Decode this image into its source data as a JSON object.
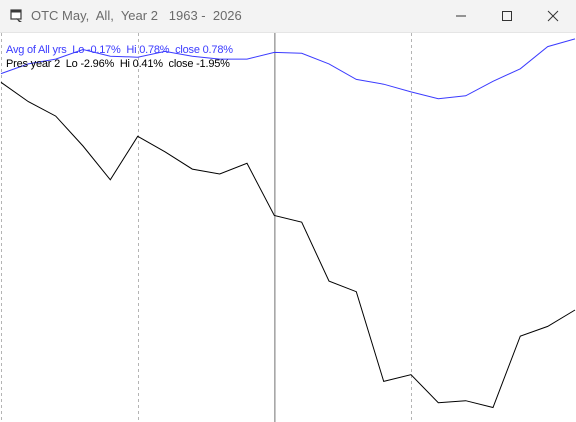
{
  "window": {
    "title": "OTC May,  All,  Year 2   1963 -  2026",
    "icon": "chart-window-icon",
    "controls": [
      "minimize-icon",
      "maximize-icon",
      "close-icon"
    ]
  },
  "legend": {
    "avg": "Avg of All yrs  Lo -0.17%  Hi 0.78%  close 0.78%",
    "pres": "Pres year 2  Lo -2.96%  Hi 0.41%  close -1.95%"
  },
  "colors": {
    "avg": "#3b3bff",
    "pres": "#000000",
    "grid": "#b4b4b4",
    "month_divider": "#a0a0a0"
  },
  "chart_data": {
    "type": "line",
    "x": [
      1,
      2,
      3,
      4,
      5,
      6,
      7,
      8,
      9,
      10,
      11,
      12,
      13,
      14,
      15,
      16,
      17,
      18,
      19,
      20,
      21,
      22
    ],
    "ylim": [
      -3.1,
      0.9
    ],
    "month_divider_after": 11,
    "vertical_gridlines_at": [
      1,
      6,
      16
    ],
    "series": [
      {
        "name": "Avg of All yrs",
        "values": [
          0.5,
          0.6,
          0.65,
          0.75,
          0.68,
          0.67,
          0.73,
          0.68,
          0.65,
          0.65,
          0.72,
          0.71,
          0.6,
          0.44,
          0.39,
          0.31,
          0.24,
          0.27,
          0.42,
          0.55,
          0.78,
          0.86
        ]
      },
      {
        "name": "Pres year 2",
        "values": [
          0.41,
          0.21,
          0.06,
          -0.25,
          -0.6,
          -0.15,
          -0.31,
          -0.49,
          -0.54,
          -0.43,
          -0.97,
          -1.04,
          -1.65,
          -1.76,
          -2.69,
          -2.62,
          -2.91,
          -2.89,
          -2.96,
          -2.22,
          -2.12,
          -1.95
        ]
      }
    ]
  }
}
